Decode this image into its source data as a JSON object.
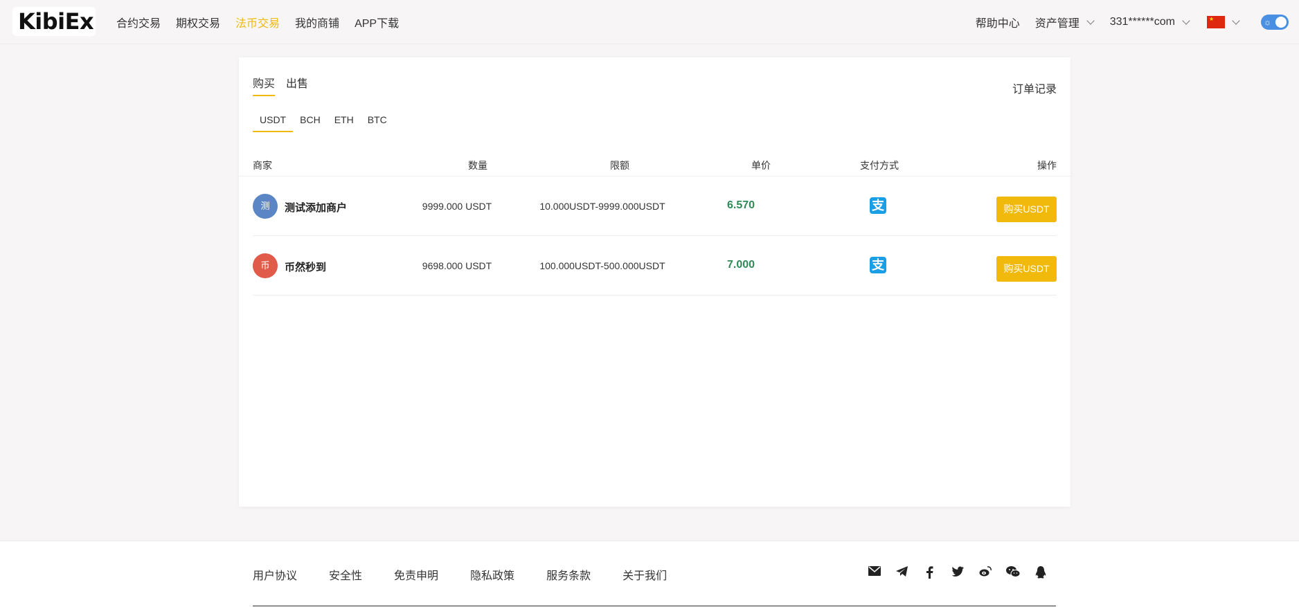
{
  "header": {
    "logo": "KibiEx",
    "nav": [
      "合约交易",
      "期权交易",
      "法币交易",
      "我的商铺",
      "APP下载"
    ],
    "help": "帮助中心",
    "assets": "资产管理",
    "account": "331******com",
    "language_icon": "china-flag-icon",
    "theme_toggle_icon": "sun-icon"
  },
  "trade": {
    "tabs": [
      "购买",
      "出售"
    ],
    "order_record": "订单记录",
    "coins": [
      "USDT",
      "BCH",
      "ETH",
      "BTC"
    ],
    "columns": [
      "商家",
      "数量",
      "限额",
      "单价",
      "支付方式",
      "操作"
    ],
    "rows": [
      {
        "avatar": "测",
        "avatar_color": "#5b86c5",
        "merchant": "测试添加商户",
        "quantity": "9999.000 USDT",
        "limit": "10.000USDT-9999.000USDT",
        "price": "6.570",
        "payment_icon": "alipay-icon",
        "payment_glyph": "支",
        "action": "购买USDT"
      },
      {
        "avatar": "币",
        "avatar_color": "#e15b4a",
        "merchant": "币然秒到",
        "quantity": "9698.000 USDT",
        "limit": "100.000USDT-500.000USDT",
        "price": "7.000",
        "payment_icon": "alipay-icon",
        "payment_glyph": "支",
        "action": "购买USDT"
      }
    ]
  },
  "footer": {
    "links": [
      "用户协议",
      "安全性",
      "免责申明",
      "隐私政策",
      "服务条款",
      "关于我们"
    ],
    "social_icons": [
      "mail-icon",
      "telegram-icon",
      "facebook-icon",
      "twitter-icon",
      "weibo-icon",
      "wechat-icon",
      "qq-icon"
    ]
  },
  "colors": {
    "accent": "#f0b90b",
    "price": "#2e8b57",
    "alipay": "#1a9ee6"
  }
}
